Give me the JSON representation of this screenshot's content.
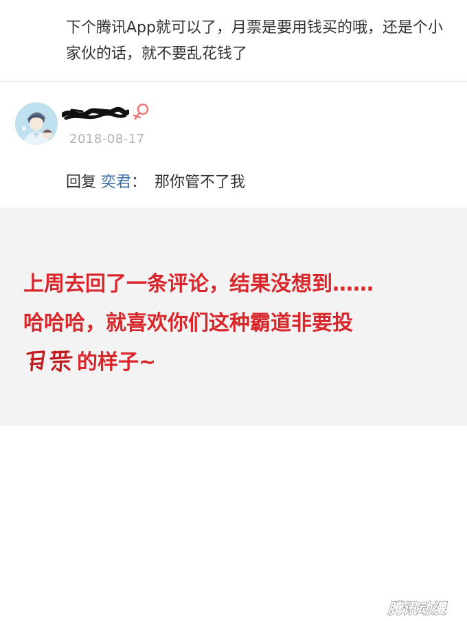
{
  "top_comment": {
    "text": "下个腾讯App就可以了，月票是要用钱买的哦，还是个小家伙的话，就不要乱花钱了"
  },
  "reply": {
    "date": "2018-08-17",
    "reply_prefix": "回复",
    "reply_target": "奕君",
    "reply_colon": "：",
    "reply_body": "那你管不了我",
    "gender": "female",
    "gender_color": "#ef6f73",
    "target_color": "#3a6ea5",
    "username_redacted": true
  },
  "caption": {
    "line1": "上周去回了一条评论，结果没想到……",
    "line2": "哈哈哈，就喜欢你们这种霸道非要投",
    "handwritten_word": "月票",
    "line3_rest": "的样子~",
    "color": "#d9262a"
  },
  "watermark": {
    "text": "腾讯动漫"
  }
}
